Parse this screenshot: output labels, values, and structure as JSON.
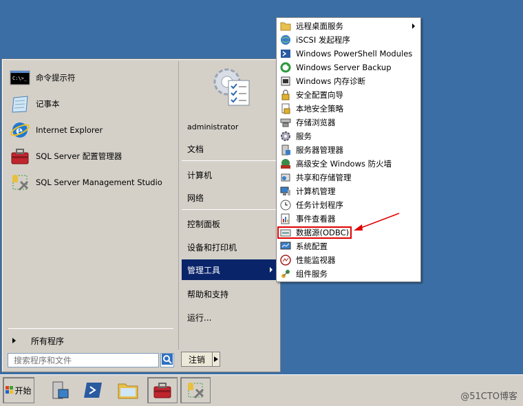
{
  "start_menu": {
    "pinned": [
      {
        "label": "命令提示符",
        "icon": "cmd-icon"
      },
      {
        "label": "记事本",
        "icon": "notepad-icon"
      },
      {
        "label": "Internet Explorer",
        "icon": "ie-icon"
      },
      {
        "label": "SQL Server 配置管理器",
        "icon": "toolbox-icon"
      },
      {
        "label": "SQL Server Management Studio",
        "icon": "ssms-icon"
      }
    ],
    "all_programs": "所有程序",
    "search_placeholder": "搜索程序和文件",
    "user_name": "administrator",
    "right_items": [
      "文档",
      "计算机",
      "网络",
      "控制面板",
      "设备和打印机",
      "管理工具",
      "帮助和支持",
      "运行..."
    ],
    "logoff_label": "注销"
  },
  "submenu": {
    "items": [
      {
        "label": "远程桌面服务",
        "icon": "folder-icon"
      },
      {
        "label": "iSCSI 发起程序",
        "icon": "globe-icon"
      },
      {
        "label": "Windows PowerShell Modules",
        "icon": "powershell-icon"
      },
      {
        "label": "Windows Server Backup",
        "icon": "backup-icon"
      },
      {
        "label": "Windows 内存诊断",
        "icon": "memory-icon"
      },
      {
        "label": "安全配置向导",
        "icon": "lock-icon"
      },
      {
        "label": "本地安全策略",
        "icon": "policy-icon"
      },
      {
        "label": "存储浏览器",
        "icon": "storage-icon"
      },
      {
        "label": "服务",
        "icon": "gear-icon"
      },
      {
        "label": "服务器管理器",
        "icon": "server-icon"
      },
      {
        "label": "高级安全 Windows 防火墙",
        "icon": "firewall-icon"
      },
      {
        "label": "共享和存储管理",
        "icon": "share-icon"
      },
      {
        "label": "计算机管理",
        "icon": "computer-icon"
      },
      {
        "label": "任务计划程序",
        "icon": "clock-icon"
      },
      {
        "label": "事件查看器",
        "icon": "event-icon"
      },
      {
        "label": "数据源(ODBC)",
        "icon": "odbc-icon"
      },
      {
        "label": "系统配置",
        "icon": "config-icon"
      },
      {
        "label": "性能监视器",
        "icon": "perf-icon"
      },
      {
        "label": "组件服务",
        "icon": "component-icon"
      }
    ]
  },
  "taskbar": {
    "start_label": "开始",
    "buttons": [
      "server-manager-icon",
      "powershell-icon",
      "explorer-icon",
      "toolbox-icon",
      "ssms-icon"
    ],
    "watermark": "@51CTO博客"
  },
  "colors": {
    "desktop": "#3a6ea5",
    "highlight": "#0a246a",
    "annotation": "#e00000"
  }
}
